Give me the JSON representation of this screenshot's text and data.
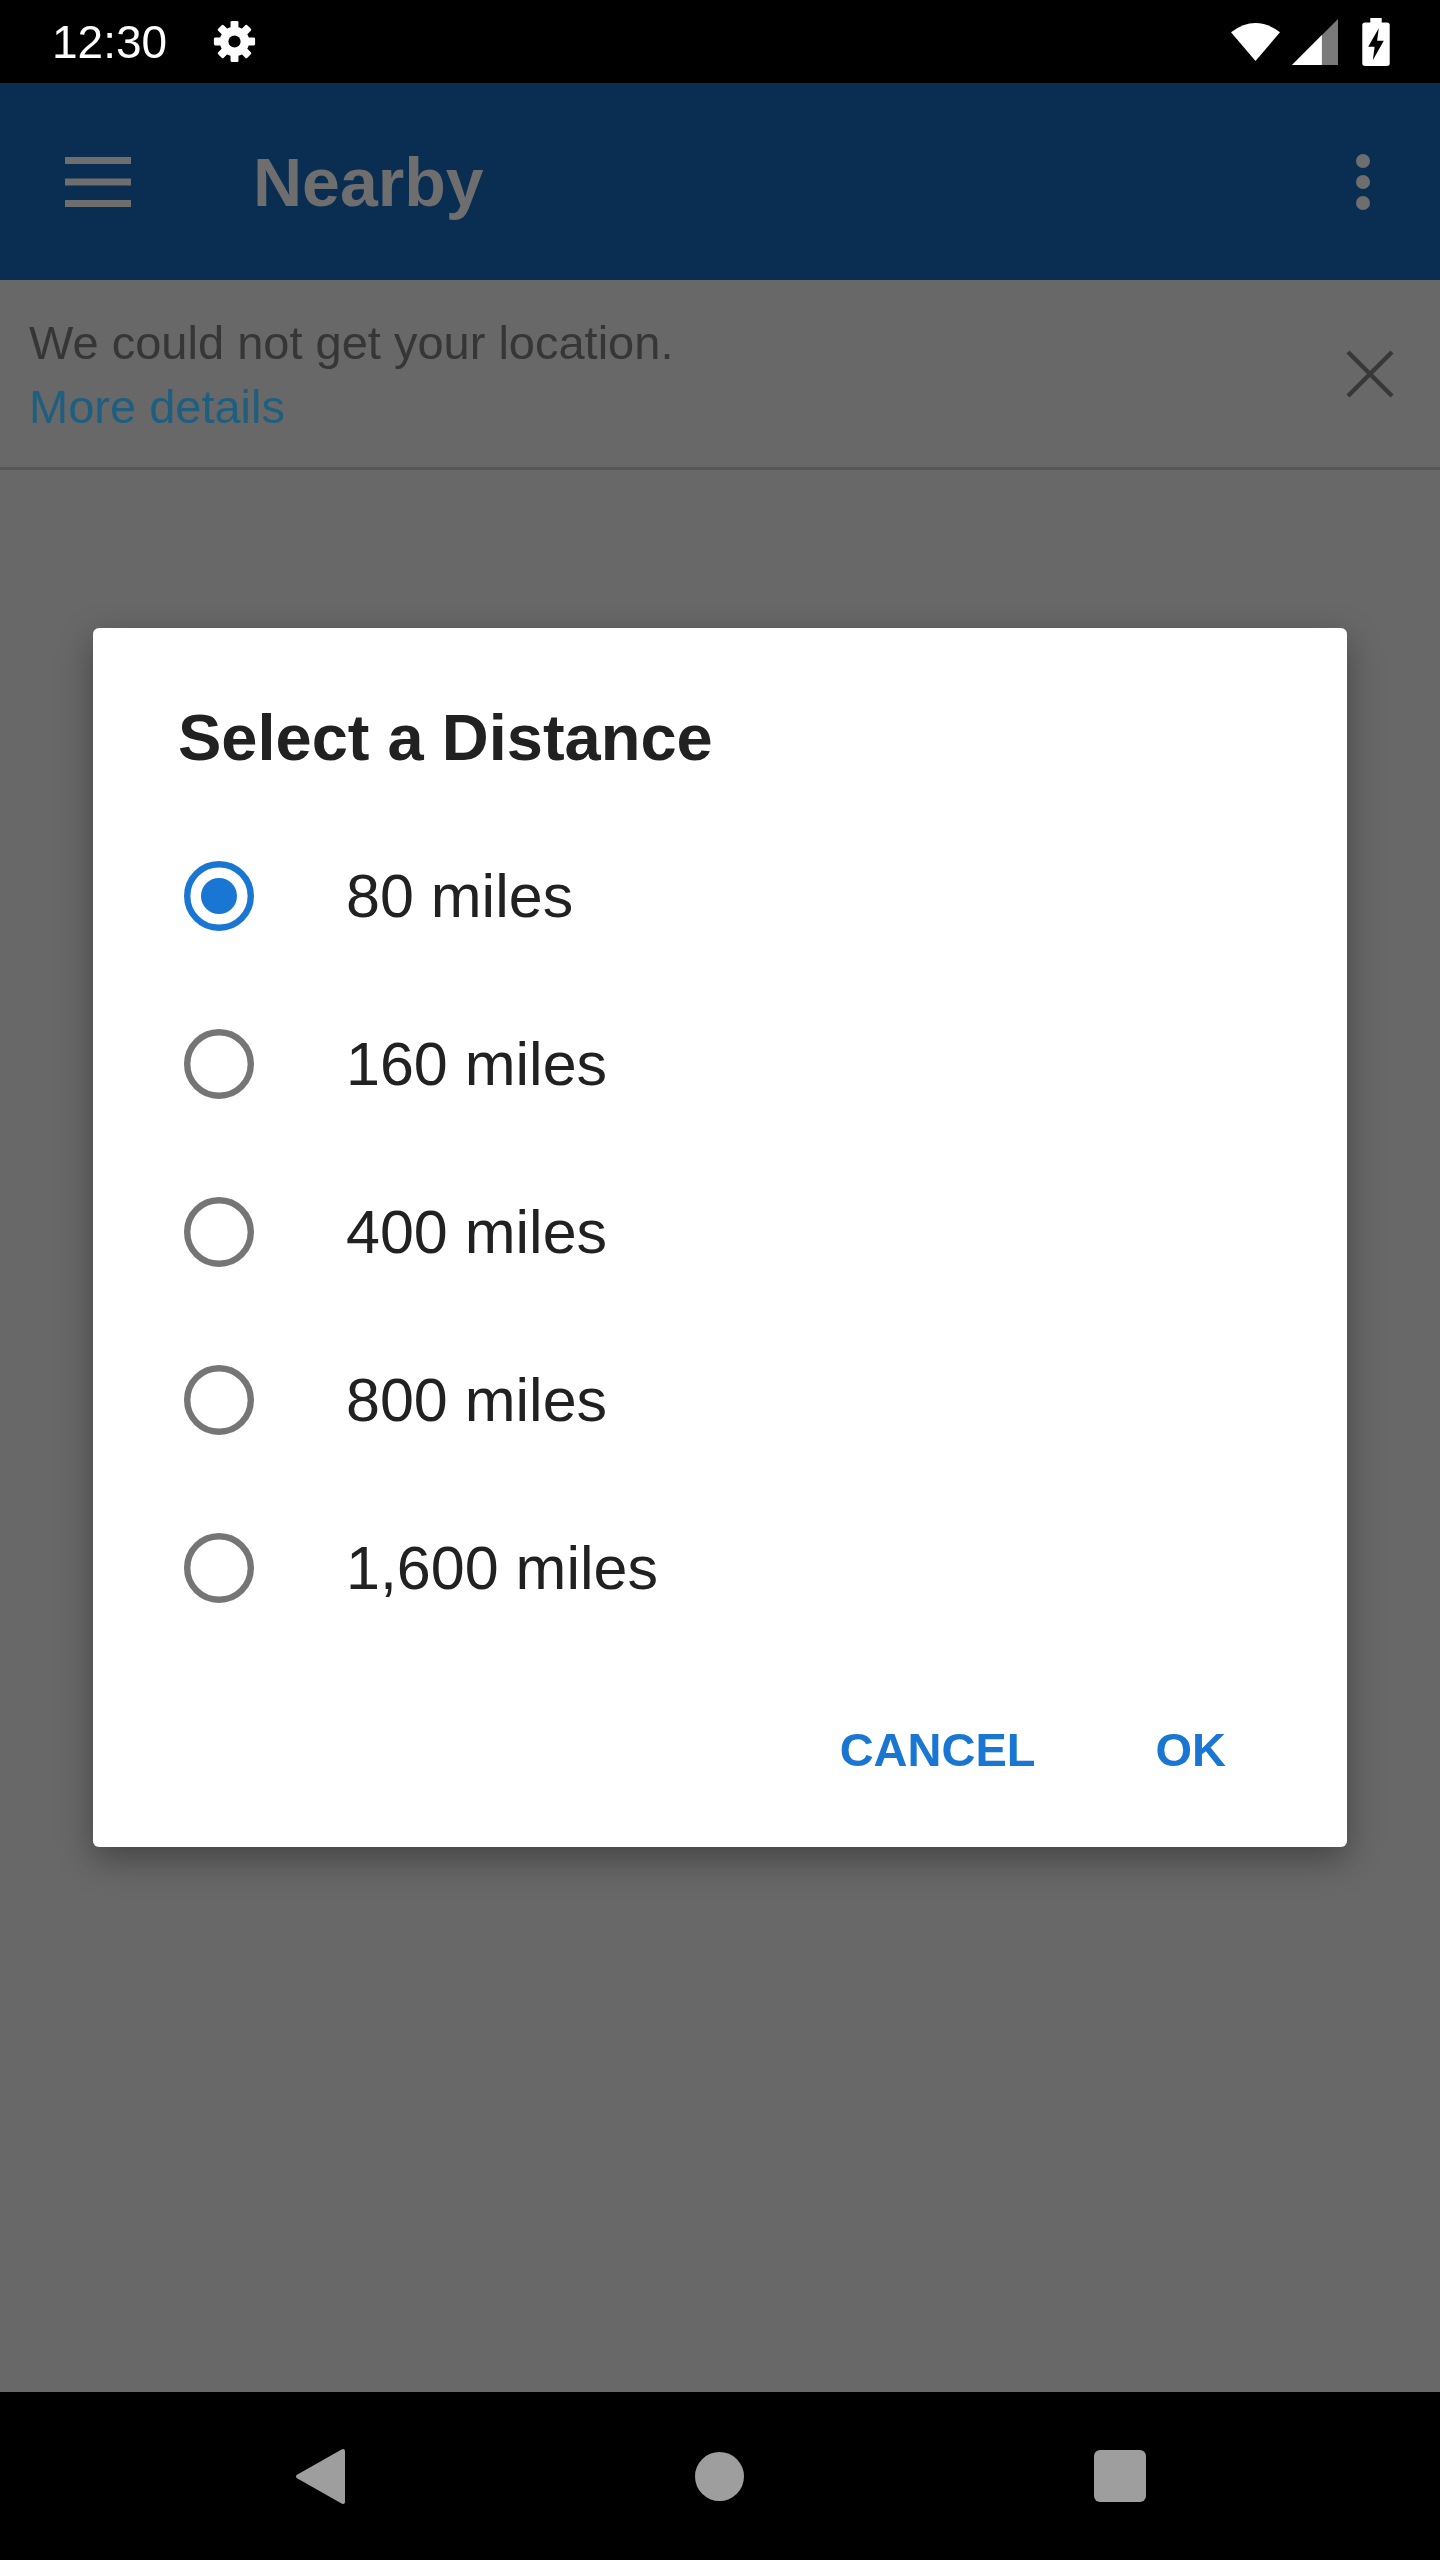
{
  "status_bar": {
    "time": "12:30"
  },
  "app_bar": {
    "title": "Nearby"
  },
  "banner": {
    "message": "We could not get your location.",
    "link": "More details"
  },
  "dialog": {
    "title": "Select a Distance",
    "options": [
      {
        "label": "80 miles",
        "selected": true
      },
      {
        "label": "160 miles",
        "selected": false
      },
      {
        "label": "400 miles",
        "selected": false
      },
      {
        "label": "800 miles",
        "selected": false
      },
      {
        "label": "1,600 miles",
        "selected": false
      }
    ],
    "buttons": [
      "CANCEL",
      "OK"
    ]
  }
}
